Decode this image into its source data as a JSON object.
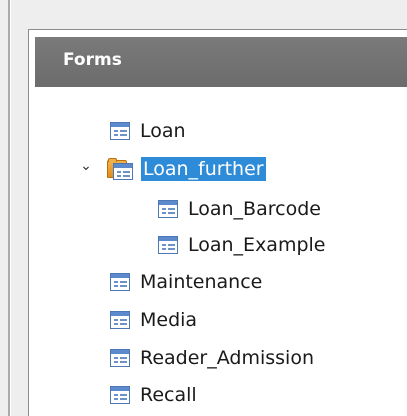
{
  "panel": {
    "title": "Forms"
  },
  "tree": {
    "items": [
      {
        "label": "Loan",
        "type": "form"
      },
      {
        "label": "Loan_further",
        "type": "folder",
        "expanded": true,
        "selected": true
      },
      {
        "label": "Loan_Barcode",
        "type": "form"
      },
      {
        "label": "Loan_Example",
        "type": "form"
      },
      {
        "label": "Maintenance",
        "type": "form"
      },
      {
        "label": "Media",
        "type": "form"
      },
      {
        "label": "Reader_Admission",
        "type": "form"
      },
      {
        "label": "Recall",
        "type": "form"
      }
    ]
  },
  "icons": {
    "form": "form-document-icon",
    "folder": "folder-with-form-icon",
    "expand": "chevron-down-icon"
  },
  "colors": {
    "header_background": "#727272",
    "selection_background": "#2e8bd8",
    "form_icon_accent": "#5d8acc",
    "folder_accent": "#e9a234"
  }
}
